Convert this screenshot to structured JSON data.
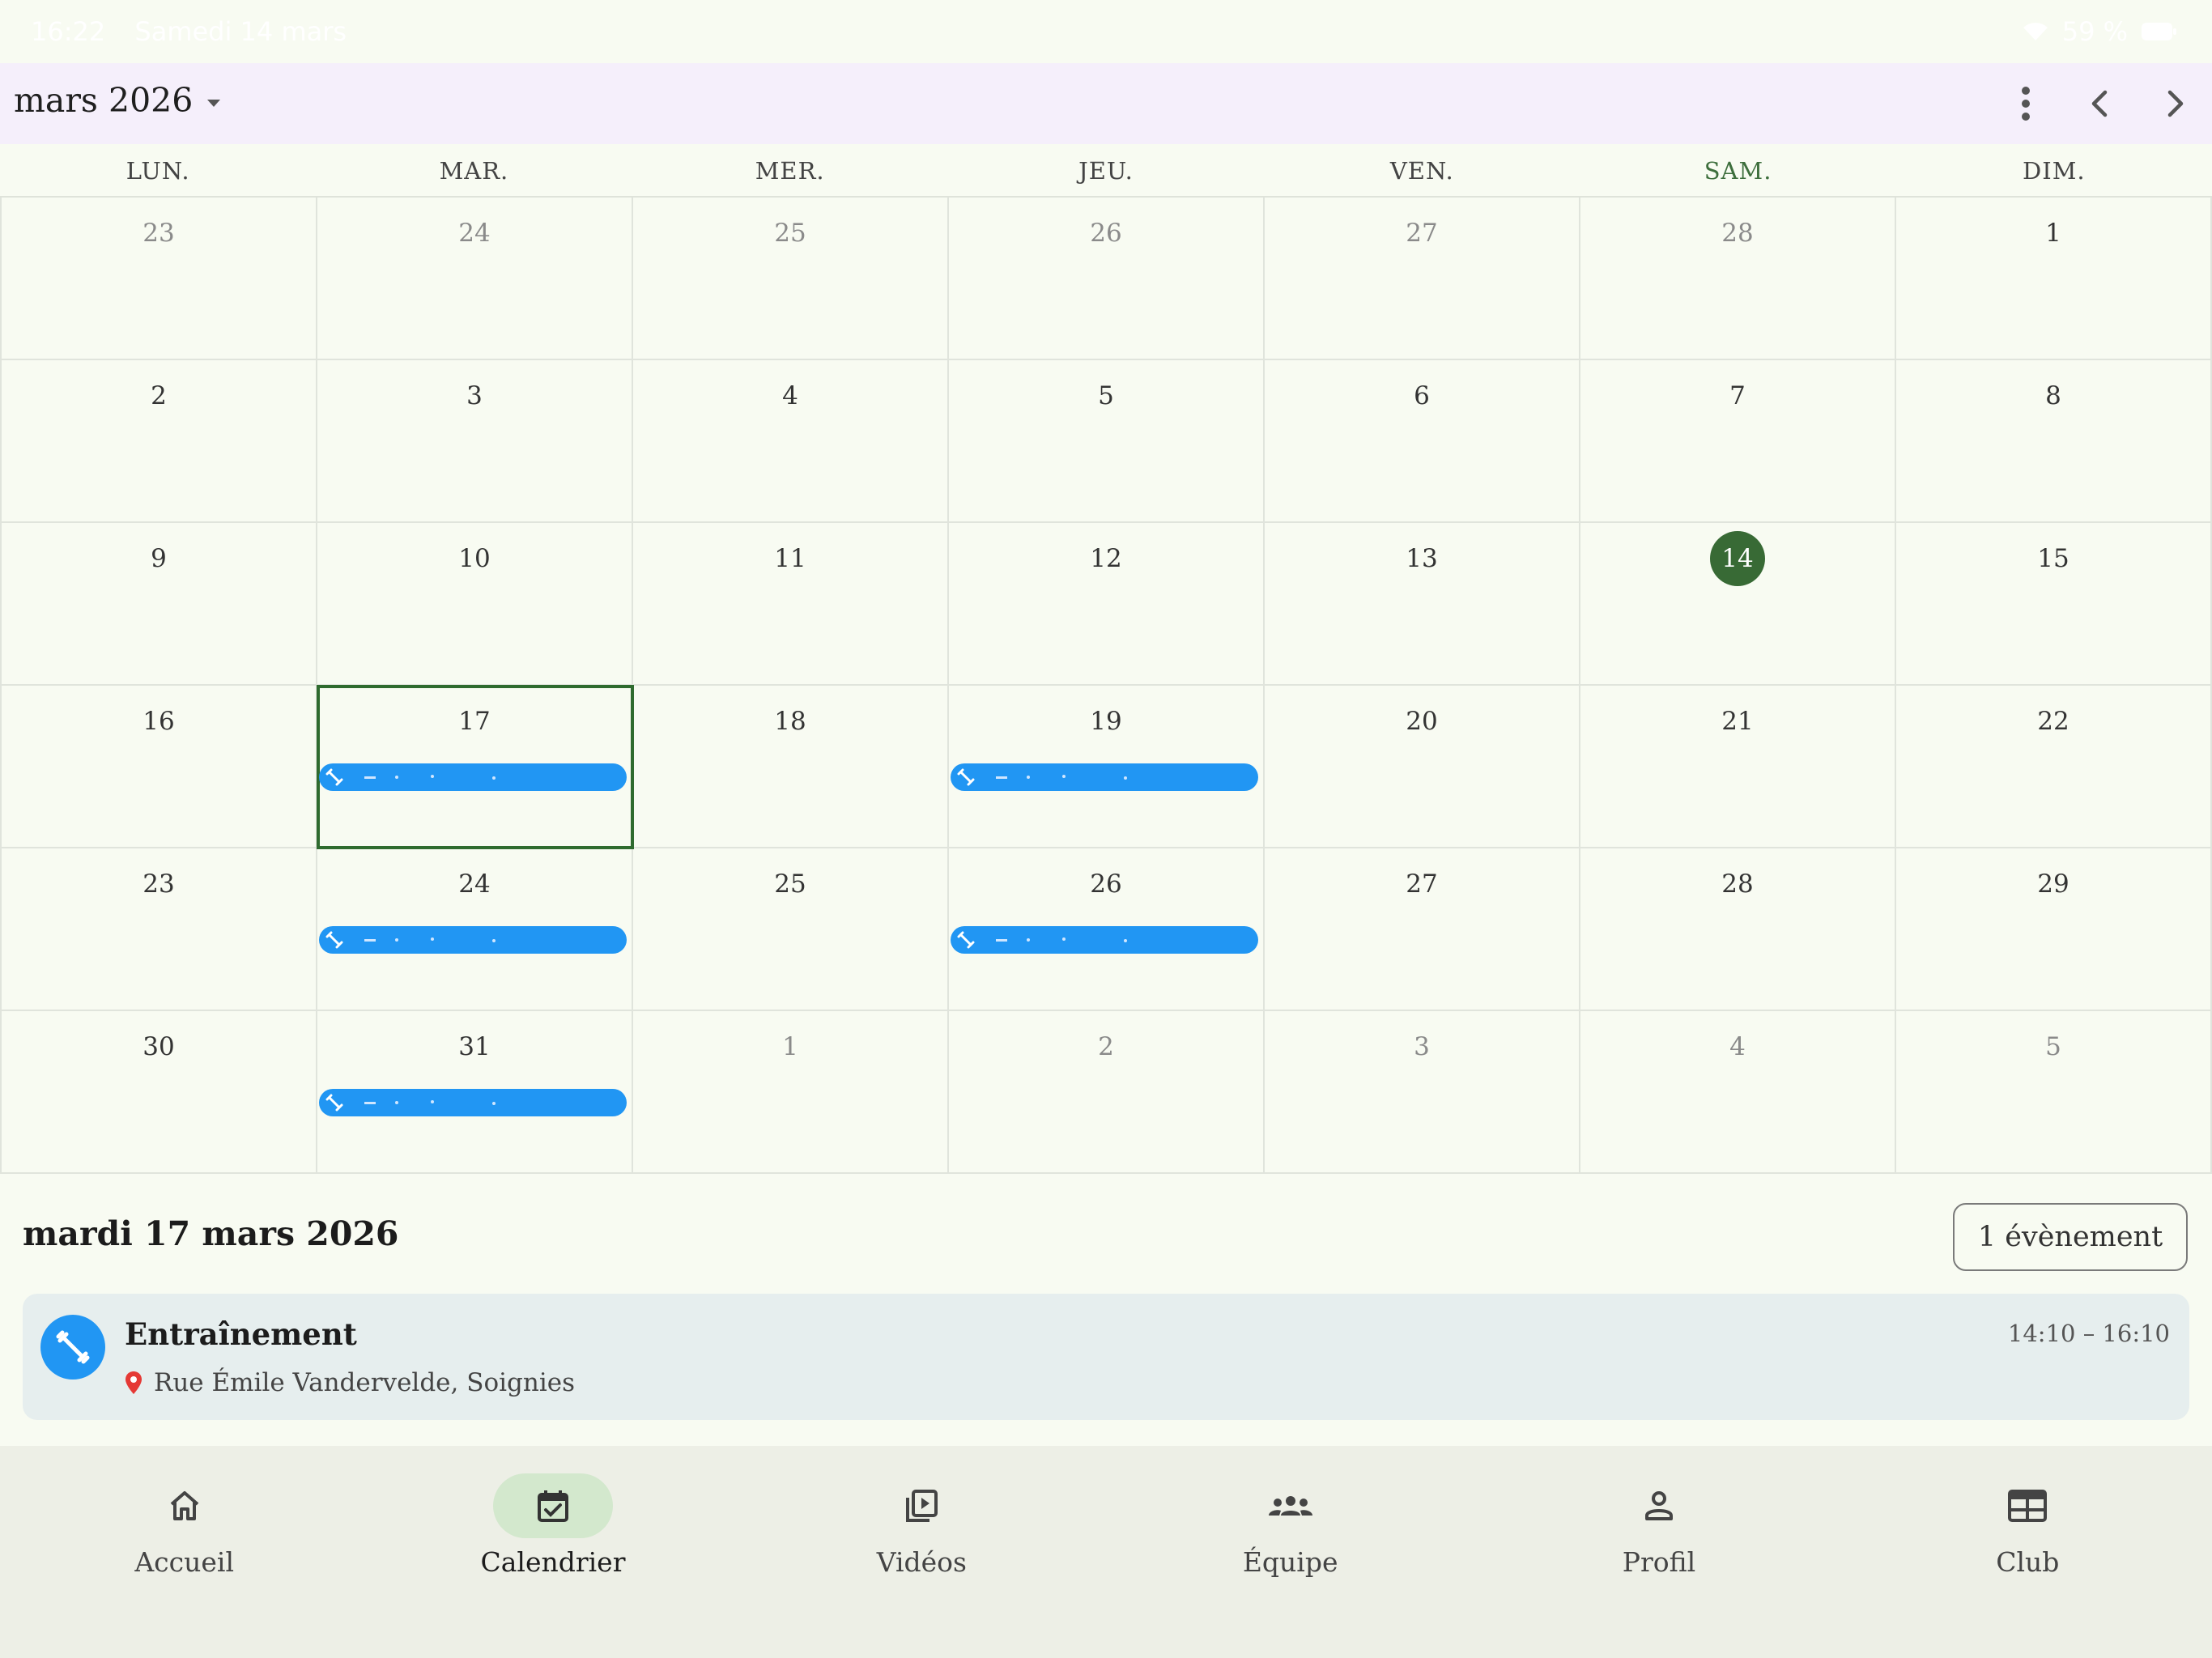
{
  "status_bar": {
    "time": "16:22",
    "date": "Samedi 14 mars",
    "battery": "59 %"
  },
  "app_bar": {
    "month": "mars 2026"
  },
  "weekdays": [
    {
      "label": "LUN."
    },
    {
      "label": "MAR."
    },
    {
      "label": "MER."
    },
    {
      "label": "JEU."
    },
    {
      "label": "VEN."
    },
    {
      "label": "SAM."
    },
    {
      "label": "DIM."
    }
  ],
  "weeks": [
    [
      {
        "d": "23",
        "other": true
      },
      {
        "d": "24",
        "other": true
      },
      {
        "d": "25",
        "other": true
      },
      {
        "d": "26",
        "other": true
      },
      {
        "d": "27",
        "other": true
      },
      {
        "d": "28",
        "other": true
      },
      {
        "d": "1"
      }
    ],
    [
      {
        "d": "2"
      },
      {
        "d": "3"
      },
      {
        "d": "4"
      },
      {
        "d": "5"
      },
      {
        "d": "6"
      },
      {
        "d": "7"
      },
      {
        "d": "8"
      }
    ],
    [
      {
        "d": "9"
      },
      {
        "d": "10"
      },
      {
        "d": "11"
      },
      {
        "d": "12"
      },
      {
        "d": "13"
      },
      {
        "d": "14",
        "today": true
      },
      {
        "d": "15"
      }
    ],
    [
      {
        "d": "16"
      },
      {
        "d": "17",
        "selected": true,
        "event": true
      },
      {
        "d": "18"
      },
      {
        "d": "19",
        "event": true
      },
      {
        "d": "20"
      },
      {
        "d": "21"
      },
      {
        "d": "22"
      }
    ],
    [
      {
        "d": "23"
      },
      {
        "d": "24",
        "event": true
      },
      {
        "d": "25"
      },
      {
        "d": "26",
        "event": true
      },
      {
        "d": "27"
      },
      {
        "d": "28"
      },
      {
        "d": "29"
      }
    ],
    [
      {
        "d": "30"
      },
      {
        "d": "31",
        "event": true
      },
      {
        "d": "1",
        "other": true
      },
      {
        "d": "2",
        "other": true
      },
      {
        "d": "3",
        "other": true
      },
      {
        "d": "4",
        "other": true
      },
      {
        "d": "5",
        "other": true
      }
    ]
  ],
  "selected_day": {
    "heading": "mardi 17 mars 2026",
    "count_label": "1 évènement"
  },
  "event": {
    "title": "Entraînement",
    "time": "14:10 – 16:10",
    "location": "Rue Émile Vandervelde, Soignies",
    "icon": "dumbbell-icon"
  },
  "nav": [
    {
      "label": "Accueil",
      "icon": "home-icon"
    },
    {
      "label": "Calendrier",
      "icon": "calendar-check-icon",
      "active": true
    },
    {
      "label": "Vidéos",
      "icon": "video-library-icon"
    },
    {
      "label": "Équipe",
      "icon": "groups-icon"
    },
    {
      "label": "Profil",
      "icon": "person-icon"
    },
    {
      "label": "Club",
      "icon": "club-icon"
    }
  ],
  "colors": {
    "accent_green": "#386a35",
    "event_blue": "#2196f3",
    "nav_active": "#d3e8cd",
    "app_bar_bg": "#f5effb"
  }
}
